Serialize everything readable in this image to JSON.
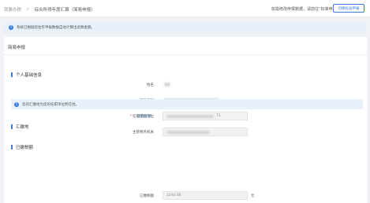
{
  "breadcrumb": {
    "parent": "我要办税",
    "sep": ">",
    "current": "综合所得年度汇算（简易申报）"
  },
  "header": {
    "hint": "如需修改申报数据，请前往“标准申报”办理。",
    "switch_button": "切换标准申报"
  },
  "notice": {
    "text": "系统已根据您往年申报数据自动计算出退税金额。"
  },
  "card": {
    "title": "简易申报"
  },
  "basic_info": {
    "section_title": "个人基础信息",
    "name_label": "姓名",
    "id_label": "证件号码",
    "view_all": "查看全部"
  },
  "remit": {
    "section_title": "汇缴地",
    "notice": "您的汇缴地为您的任职单位所在地。",
    "employer_label": "任职受雇单位",
    "employer_suffix": "71",
    "tax_office_label": "主管税务机关"
  },
  "prepaid": {
    "section_title": "已缴税额",
    "paid_label": "已缴税额",
    "paid_value": "2240.00",
    "unit": "元"
  },
  "colors": {
    "accent": "#3a7de1",
    "notice_bg": "#e8f0fb",
    "required": "#e04040"
  }
}
